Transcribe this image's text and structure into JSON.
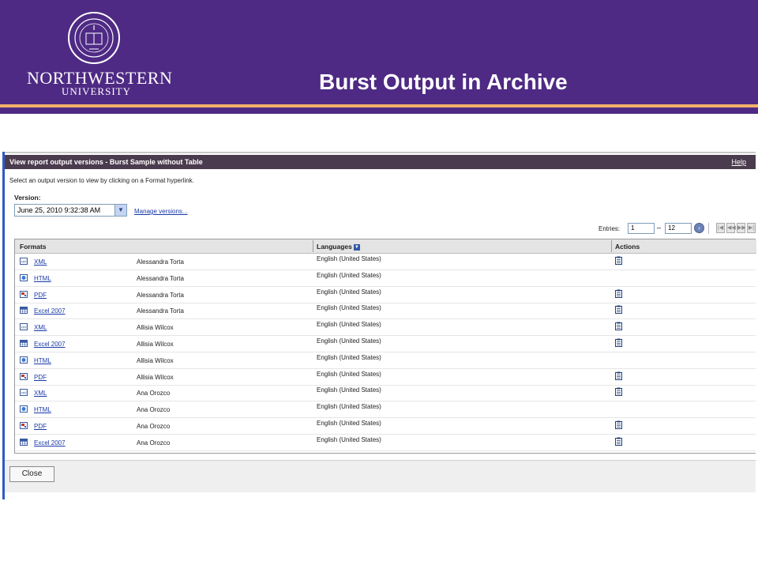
{
  "slide": {
    "title": "Burst Output in Archive",
    "logo_name": "NORTHWESTERN",
    "logo_sub": "UNIVERSITY",
    "brand_color": "#4e2a84",
    "stripe_color": "#f3b06a"
  },
  "dialog": {
    "title": "View report output versions - Burst Sample without Table",
    "help_label": "Help",
    "instruction": "Select an output version to view by clicking on a Format hyperlink.",
    "version_label": "Version:",
    "version_value": "June 25, 2010 9:32:38 AM",
    "manage_label": "Manage versions...",
    "entries_label": "Entries:",
    "entries_from": "1",
    "entries_to": "12",
    "close_label": "Close"
  },
  "table": {
    "headers": {
      "formats": "Formats",
      "languages": "Languages",
      "actions": "Actions"
    },
    "rows": [
      {
        "format": "XML",
        "icon": "xml-icon",
        "owner": "Alessandra Torta",
        "language": "English (United States)",
        "action": true
      },
      {
        "format": "HTML",
        "icon": "html-icon",
        "owner": "Alessandra Torta",
        "language": "English (United States)",
        "action": false
      },
      {
        "format": "PDF",
        "icon": "pdf-icon",
        "owner": "Alessandra Torta",
        "language": "English (United States)",
        "action": true
      },
      {
        "format": "Excel 2007",
        "icon": "excel-icon",
        "owner": "Alessandra Torta",
        "language": "English (United States)",
        "action": true
      },
      {
        "format": "XML",
        "icon": "xml-icon",
        "owner": "Allisia Wilcox",
        "language": "English (United States)",
        "action": true
      },
      {
        "format": "Excel 2007",
        "icon": "excel-icon",
        "owner": "Allisia Wilcox",
        "language": "English (United States)",
        "action": true
      },
      {
        "format": "HTML",
        "icon": "html-icon",
        "owner": "Allisia Wilcox",
        "language": "English (United States)",
        "action": false
      },
      {
        "format": "PDF",
        "icon": "pdf-icon",
        "owner": "Allisia Wilcox",
        "language": "English (United States)",
        "action": true
      },
      {
        "format": "XML",
        "icon": "xml-icon",
        "owner": "Ana Orozco",
        "language": "English (United States)",
        "action": true
      },
      {
        "format": "HTML",
        "icon": "html-icon",
        "owner": "Ana Orozco",
        "language": "English (United States)",
        "action": false
      },
      {
        "format": "PDF",
        "icon": "pdf-icon",
        "owner": "Ana Orozco",
        "language": "English (United States)",
        "action": true
      },
      {
        "format": "Excel 2007",
        "icon": "excel-icon",
        "owner": "Ana Orozco",
        "language": "English (United States)",
        "action": true
      }
    ]
  }
}
